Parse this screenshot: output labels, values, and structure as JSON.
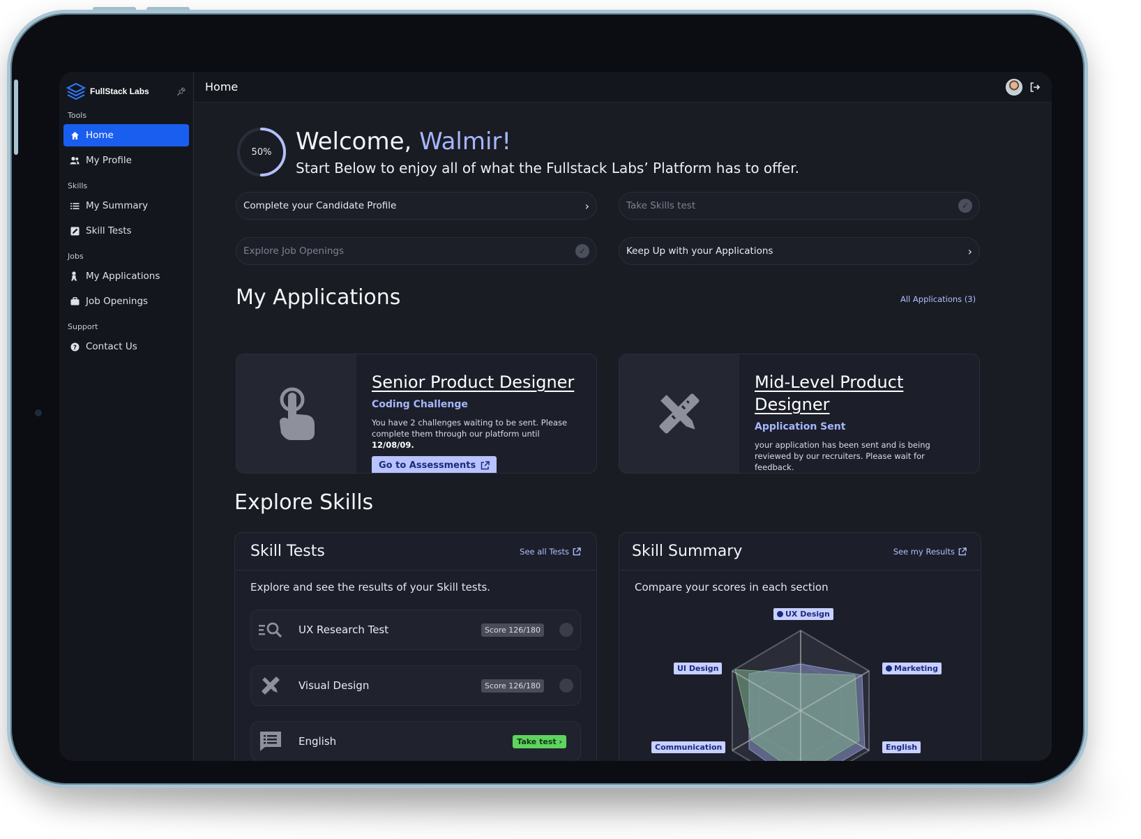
{
  "brand": {
    "name": "FullStack Labs"
  },
  "sidebar": {
    "sections": [
      {
        "label": "Tools",
        "items": [
          {
            "label": "Home",
            "icon": "home-icon",
            "active": true
          },
          {
            "label": "My Profile",
            "icon": "users-icon"
          }
        ]
      },
      {
        "label": "Skills",
        "items": [
          {
            "label": "My Summary",
            "icon": "list-icon"
          },
          {
            "label": "Skill Tests",
            "icon": "edit-icon"
          }
        ]
      },
      {
        "label": "Jobs",
        "items": [
          {
            "label": "My Applications",
            "icon": "dollar-icon"
          },
          {
            "label": "Job Openings",
            "icon": "briefcase-icon"
          }
        ]
      },
      {
        "label": "Support",
        "items": [
          {
            "label": "Contact Us",
            "icon": "help-icon"
          }
        ]
      }
    ]
  },
  "topbar": {
    "title": "Home"
  },
  "welcome": {
    "progress_text": "50%",
    "progress": 0.5,
    "greeting": "Welcome, ",
    "name": "Walmir!",
    "subtitle": "Start Below to enjoy all of what the Fullstack Labs’ Platform has to offer."
  },
  "steps": [
    {
      "label": "Complete your Candidate Profile",
      "state": "todo"
    },
    {
      "label": "Take Skills test",
      "state": "done"
    },
    {
      "label": "Explore Job Openings",
      "state": "done"
    },
    {
      "label": "Keep Up with your Applications",
      "state": "todo"
    }
  ],
  "applications": {
    "heading": "My Applications",
    "all_link": "All Applications (3)",
    "cards": [
      {
        "title": "Senior Product Designer",
        "status": "Coding Challenge",
        "desc": "You have 2 challenges waiting to be sent. Please complete them through our platform until ",
        "date": "12/08/09.",
        "button": "Go to Assessments"
      },
      {
        "title_line1": "Mid-Level Product",
        "title_line2": "Designer",
        "status": "Application Sent",
        "desc": "your application has been sent and is being reviewed by our recruiters. Please wait for feedback."
      }
    ]
  },
  "explore": {
    "heading": "Explore Skills",
    "skill_tests": {
      "title": "Skill Tests",
      "link": "See all Tests",
      "subtitle": "Explore and see the results of your Skill tests.",
      "rows": [
        {
          "name": "UX Research Test",
          "badge": "Score 126/180",
          "icon": "research-icon"
        },
        {
          "name": "Visual Design",
          "badge": "Score 126/180",
          "icon": "design-tools-icon"
        },
        {
          "name": "English",
          "badge": "Take test ›",
          "icon": "chat-list-icon"
        }
      ]
    },
    "skill_summary": {
      "title": "Skill Summary",
      "link": "See my Results",
      "subtitle": "Compare your scores in each section",
      "labels": {
        "ux": "UX Design",
        "marketing": "Marketing",
        "english": "English",
        "communication": "Communication",
        "ui": "UI Design"
      }
    }
  },
  "colors": {
    "accent": "#1a5ef0",
    "link": "#b2bfff",
    "background": "#1a1c24",
    "sidebar": "#14161d",
    "take_test": "#5fd35f"
  }
}
